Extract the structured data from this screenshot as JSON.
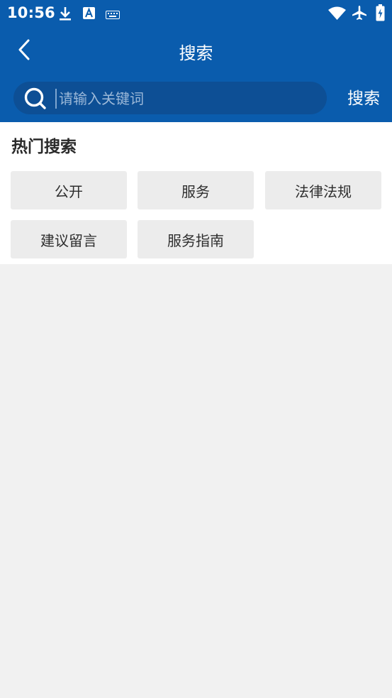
{
  "status_bar": {
    "time": "10:56",
    "icons": [
      "download-icon",
      "font-app-icon",
      "keyboard-icon",
      "wifi-icon",
      "airplane-icon",
      "battery-charging-icon"
    ]
  },
  "header": {
    "title": "搜索",
    "back_icon": "chevron-left-icon"
  },
  "search": {
    "placeholder": "请输入关键词",
    "value": "",
    "button_label": "搜索",
    "icon": "search-icon"
  },
  "hot_search": {
    "title": "热门搜索",
    "tags": [
      "公开",
      "服务",
      "法律法规",
      "建议留言",
      "服务指南"
    ]
  },
  "colors": {
    "brand_blue": "#0a5cad",
    "search_box": "#0d4f95",
    "tag_bg": "#ececec",
    "page_bg": "#f1f1f1"
  }
}
